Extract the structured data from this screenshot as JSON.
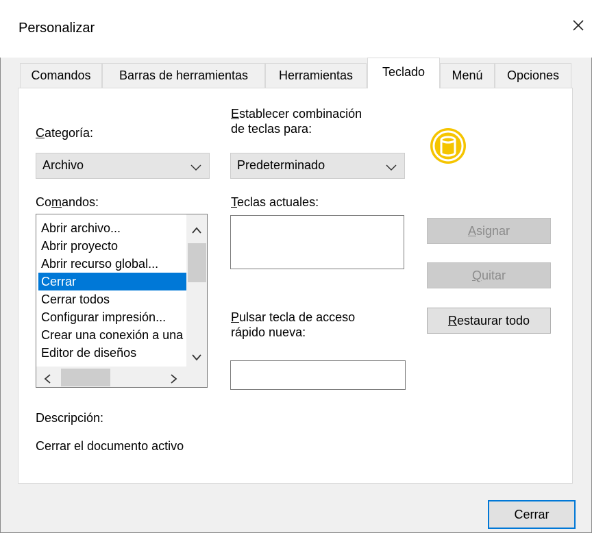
{
  "window": {
    "title": "Personalizar"
  },
  "tabs": [
    {
      "label": "Comandos"
    },
    {
      "label": "Barras de herramientas"
    },
    {
      "label": "Herramientas"
    },
    {
      "label": "Teclado"
    },
    {
      "label": "Menú"
    },
    {
      "label": "Opciones"
    }
  ],
  "active_tab": "Teclado",
  "category": {
    "label_first": "C",
    "label_rest": "ategoría:",
    "selected": "Archivo"
  },
  "set_keys_for": {
    "label_line1_first": "E",
    "label_line1_rest": "stablecer combinación",
    "label_line2": "de teclas para:",
    "selected": "Predeterminado"
  },
  "commands": {
    "label_first": "Co",
    "label_underlined": "m",
    "label_rest": "andos:",
    "items": [
      "Abrir archivo...",
      "Abrir proyecto",
      "Abrir recurso global...",
      "Cerrar",
      "Cerrar todos",
      "Configurar impresión...",
      "Crear una conexión a una",
      "Editor de diseños"
    ],
    "selected_item": "Cerrar"
  },
  "current_keys": {
    "label_first": "T",
    "label_rest": "eclas actuales:",
    "value": ""
  },
  "new_shortcut": {
    "label_line1_first": "P",
    "label_line1_rest": "ulsar tecla de acceso",
    "label_line2": "rápido nueva:",
    "value": ""
  },
  "buttons": {
    "assign_first": "A",
    "assign_rest": "signar",
    "remove_first": "Q",
    "remove_rest": "uitar",
    "restore_first": "R",
    "restore_rest": "estaurar todo",
    "close": "Cerrar"
  },
  "description": {
    "label": "Descripción:",
    "text": "Cerrar el documento activo"
  },
  "icons": {
    "close": "close-icon",
    "dropdown": "chevron-down-icon",
    "database": "database-icon",
    "scroll_up": "scroll-up-arrow-icon",
    "scroll_down": "scroll-down-arrow-icon",
    "scroll_left": "scroll-left-arrow-icon",
    "scroll_right": "scroll-right-arrow-icon"
  },
  "colors": {
    "selection": "#0078d7",
    "icon_yellow": "#f5c400",
    "default_button_border": "#0078d7"
  }
}
